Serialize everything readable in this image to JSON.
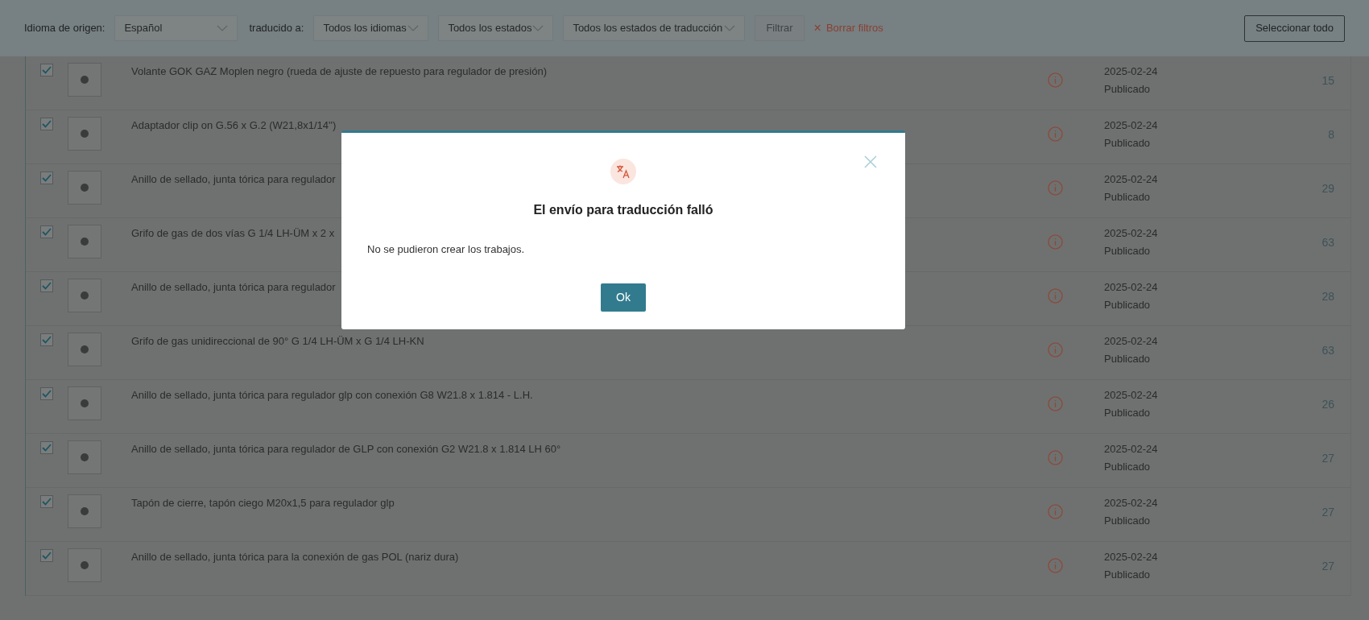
{
  "filter_bar": {
    "source_label": "Idioma de origen:",
    "source_select": {
      "value": "Español"
    },
    "target_label": "traducido a:",
    "selects": [
      {
        "value": "Todos los idiomas"
      },
      {
        "value": "Todos los estados"
      },
      {
        "value": "Todos los estados de traducción"
      }
    ],
    "filter_button": {
      "label": "Filtrar",
      "disabled": true
    },
    "clear_link": {
      "icon": "×",
      "label": "Borrar filtros"
    },
    "select_all_button": "Seleccionar todo"
  },
  "rows": [
    {
      "checked": true,
      "title": "Volante GOK GAZ Moplen negro (rueda de ajuste de repuesto para regulador de presión)",
      "date": "2025-02-24",
      "status": "Publicado",
      "count": "15"
    },
    {
      "checked": true,
      "title": "Adaptador clip on G.56 x G.2 (W21,8x1/14'')",
      "date": "2025-02-24",
      "status": "Publicado",
      "count": "8"
    },
    {
      "checked": true,
      "title": "Anillo de sellado, junta tórica para regulador",
      "date": "2025-02-24",
      "status": "Publicado",
      "count": "29"
    },
    {
      "checked": true,
      "title": "Grifo de gas de dos vías G 1/4 LH-ÜM x 2 x",
      "date": "2025-02-24",
      "status": "Publicado",
      "count": "63"
    },
    {
      "checked": true,
      "title": "Anillo de sellado, junta tórica para regulador",
      "date": "2025-02-24",
      "status": "Publicado",
      "count": "28"
    },
    {
      "checked": true,
      "title": "Grifo de gas unidireccional de 90° G 1/4 LH-ÜM x G 1/4 LH-KN",
      "date": "2025-02-24",
      "status": "Publicado",
      "count": "63"
    },
    {
      "checked": true,
      "title": "Anillo de sellado, junta tórica para regulador glp con conexión G8 W21.8 x 1.814 - L.H.",
      "date": "2025-02-24",
      "status": "Publicado",
      "count": "26"
    },
    {
      "checked": true,
      "title": "Anillo de sellado, junta tórica para regulador de GLP con conexión G2 W21.8 x 1.814 LH 60°",
      "date": "2025-02-24",
      "status": "Publicado",
      "count": "27"
    },
    {
      "checked": true,
      "title": "Tapón de cierre, tapón ciego M20x1,5 para regulador glp",
      "date": "2025-02-24",
      "status": "Publicado",
      "count": "27"
    },
    {
      "checked": true,
      "title": "Anillo de sellado, junta tórica para la conexión de gas POL (nariz dura)",
      "date": "2025-02-24",
      "status": "Publicado",
      "count": "27"
    }
  ],
  "dialog": {
    "title": "El envío para traducción falló",
    "message": "No se pudieron crear los trabajos.",
    "ok_button": "Ok"
  }
}
